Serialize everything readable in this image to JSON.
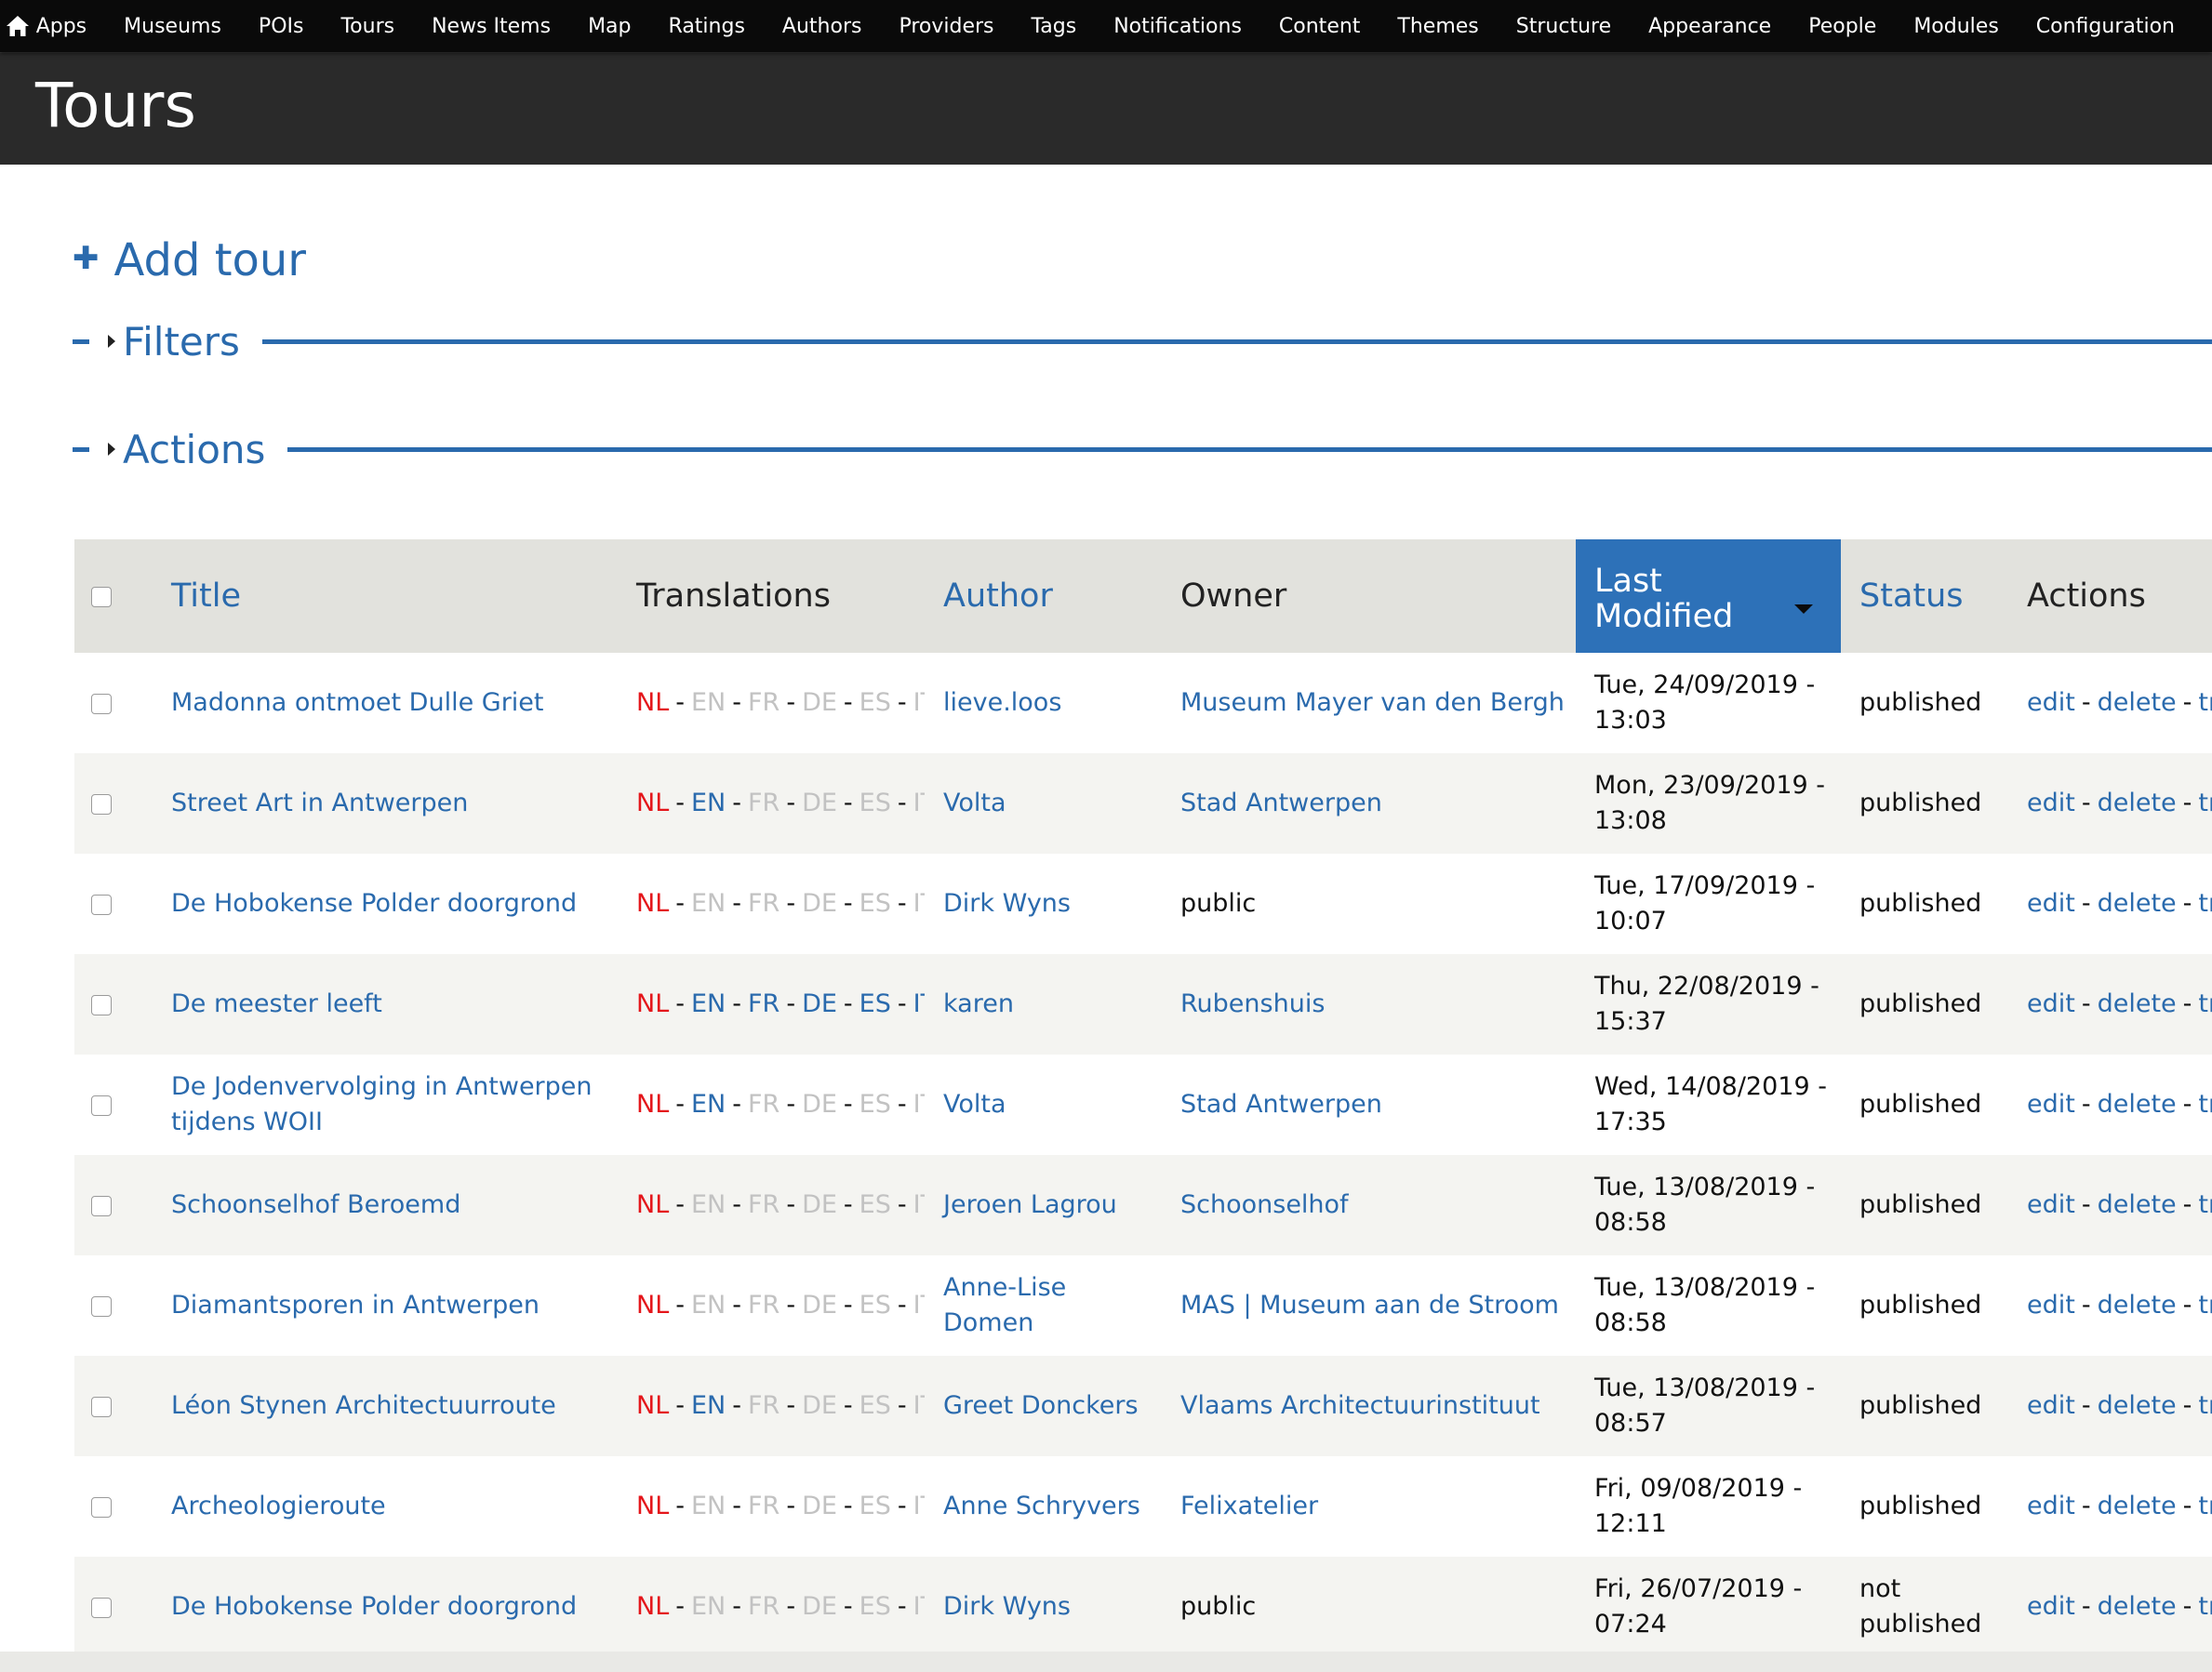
{
  "toolbar": {
    "home_icon": "home-icon",
    "items": [
      "Apps",
      "Museums",
      "POIs",
      "Tours",
      "News Items",
      "Map",
      "Ratings",
      "Authors",
      "Providers",
      "Tags",
      "Notifications",
      "Content",
      "Themes",
      "Structure",
      "Appearance",
      "People",
      "Modules",
      "Configuration"
    ]
  },
  "page": {
    "title": "Tours",
    "add_link_icon": "plus-icon",
    "add_link": "Add tour"
  },
  "fieldsets": {
    "filters": "Filters",
    "actions": "Actions"
  },
  "table": {
    "headers": {
      "title": "Title",
      "translations": "Translations",
      "author": "Author",
      "owner": "Owner",
      "last_modified_line1": "Last",
      "last_modified_line2": "Modified",
      "status": "Status",
      "actions": "Actions"
    },
    "languages": [
      "NL",
      "EN",
      "FR",
      "DE",
      "ES",
      "IT"
    ],
    "colors": {
      "lang_available": "#2a6aad",
      "lang_original": "#e4161b",
      "lang_missing": "#c2c2c2"
    },
    "action_links": [
      "edit",
      "delete",
      "trans"
    ],
    "rows": [
      {
        "title": "Madonna ontmoet Dulle Griet",
        "langs": [
          1,
          0,
          0,
          0,
          0,
          0
        ],
        "author": "lieve.loos",
        "owner": "Museum Mayer van den Bergh",
        "owner_link": true,
        "modified_1": "Tue, 24/09/2019 -",
        "modified_2": "13:03",
        "status": "published"
      },
      {
        "title": "Street Art in Antwerpen",
        "langs": [
          1,
          1,
          0,
          0,
          0,
          0
        ],
        "author": "Volta",
        "owner": "Stad Antwerpen",
        "owner_link": true,
        "modified_1": "Mon, 23/09/2019 -",
        "modified_2": "13:08",
        "status": "published"
      },
      {
        "title": "De Hobokense Polder doorgrond",
        "langs": [
          1,
          0,
          0,
          0,
          0,
          0
        ],
        "author": "Dirk Wyns",
        "owner": "public",
        "owner_link": false,
        "modified_1": "Tue, 17/09/2019 -",
        "modified_2": "10:07",
        "status": "published"
      },
      {
        "title": "De meester leeft",
        "langs": [
          1,
          1,
          1,
          1,
          1,
          1
        ],
        "author": "karen",
        "owner": "Rubenshuis",
        "owner_link": true,
        "modified_1": "Thu, 22/08/2019 -",
        "modified_2": "15:37",
        "status": "published"
      },
      {
        "title": "De Jodenvervolging in Antwerpen tijdens WOII",
        "langs": [
          1,
          1,
          0,
          0,
          0,
          0
        ],
        "author": "Volta",
        "owner": "Stad Antwerpen",
        "owner_link": true,
        "modified_1": "Wed, 14/08/2019 -",
        "modified_2": "17:35",
        "status": "published"
      },
      {
        "title": "Schoonselhof Beroemd",
        "langs": [
          1,
          0,
          0,
          0,
          0,
          0
        ],
        "author": "Jeroen Lagrou",
        "owner": "Schoonselhof",
        "owner_link": true,
        "modified_1": "Tue, 13/08/2019 -",
        "modified_2": "08:58",
        "status": "published"
      },
      {
        "title": "Diamantsporen in Antwerpen",
        "langs": [
          1,
          0,
          0,
          0,
          0,
          0
        ],
        "author": "Anne-Lise Domen",
        "owner": "MAS | Museum aan de Stroom",
        "owner_link": true,
        "modified_1": "Tue, 13/08/2019 -",
        "modified_2": "08:58",
        "status": "published"
      },
      {
        "title": "Léon Stynen Architectuurroute",
        "langs": [
          1,
          1,
          0,
          0,
          0,
          0
        ],
        "author": "Greet Donckers",
        "owner": "Vlaams Architectuurinstituut",
        "owner_link": true,
        "modified_1": "Tue, 13/08/2019 -",
        "modified_2": "08:57",
        "status": "published"
      },
      {
        "title": "Archeologieroute",
        "langs": [
          1,
          0,
          0,
          0,
          0,
          0
        ],
        "author": "Anne Schryvers",
        "owner": "Felixatelier",
        "owner_link": true,
        "modified_1": "Fri, 09/08/2019 -",
        "modified_2": "12:11",
        "status": "published"
      },
      {
        "title": "De Hobokense Polder doorgrond",
        "langs": [
          1,
          0,
          0,
          0,
          0,
          0
        ],
        "author": "Dirk Wyns",
        "owner": "public",
        "owner_link": false,
        "modified_1": "Fri, 26/07/2019 -",
        "modified_2": "07:24",
        "status": "not published"
      }
    ]
  }
}
